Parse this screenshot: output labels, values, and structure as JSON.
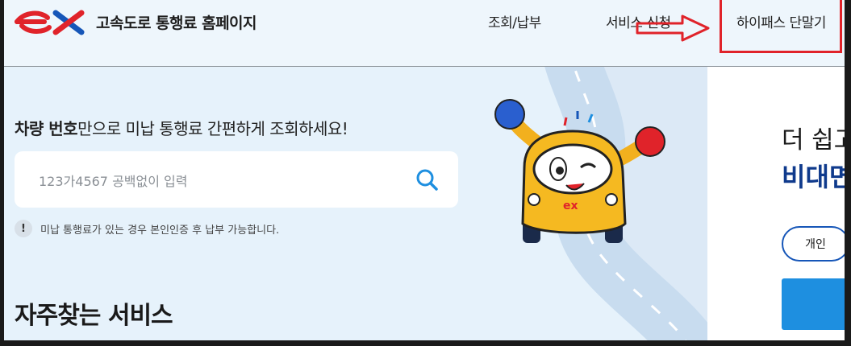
{
  "header": {
    "title": "고속도로 통행료 홈페이지",
    "nav": [
      "조회/납부",
      "서비스 신청",
      "하이패스 단말기"
    ]
  },
  "search": {
    "heading_bold": "차량 번호",
    "heading_rest": "만으로 미납 통행료 간편하게 조회하세요!",
    "placeholder": "123가4567 공백없이 입력",
    "notice": "미납 통행료가 있는 경우 본인인증 후 납부 가능합니다."
  },
  "services": {
    "title": "자주찾는 서비스"
  },
  "right_panel": {
    "line1": "더 쉽고",
    "line2": "비대면",
    "tab_personal": "개인"
  },
  "colors": {
    "accent": "#e0232a",
    "brand_blue": "#1656b8",
    "button_blue": "#1e8fe0"
  },
  "icons": [
    "ex-logo",
    "search-icon",
    "exclamation-icon",
    "red-arrow"
  ]
}
